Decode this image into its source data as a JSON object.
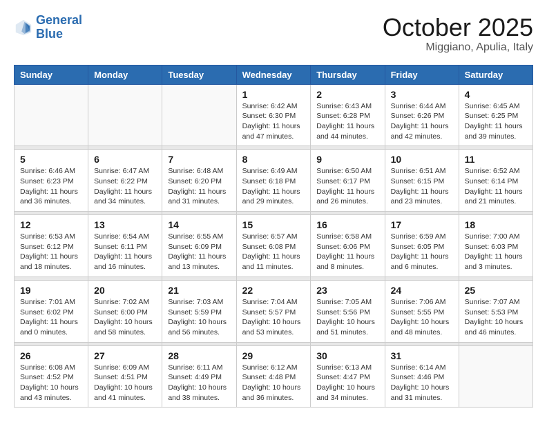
{
  "header": {
    "logo_line1": "General",
    "logo_line2": "Blue",
    "month": "October 2025",
    "location": "Miggiano, Apulia, Italy"
  },
  "weekdays": [
    "Sunday",
    "Monday",
    "Tuesday",
    "Wednesday",
    "Thursday",
    "Friday",
    "Saturday"
  ],
  "weeks": [
    [
      {
        "day": "",
        "info": ""
      },
      {
        "day": "",
        "info": ""
      },
      {
        "day": "",
        "info": ""
      },
      {
        "day": "1",
        "info": "Sunrise: 6:42 AM\nSunset: 6:30 PM\nDaylight: 11 hours\nand 47 minutes."
      },
      {
        "day": "2",
        "info": "Sunrise: 6:43 AM\nSunset: 6:28 PM\nDaylight: 11 hours\nand 44 minutes."
      },
      {
        "day": "3",
        "info": "Sunrise: 6:44 AM\nSunset: 6:26 PM\nDaylight: 11 hours\nand 42 minutes."
      },
      {
        "day": "4",
        "info": "Sunrise: 6:45 AM\nSunset: 6:25 PM\nDaylight: 11 hours\nand 39 minutes."
      }
    ],
    [
      {
        "day": "5",
        "info": "Sunrise: 6:46 AM\nSunset: 6:23 PM\nDaylight: 11 hours\nand 36 minutes."
      },
      {
        "day": "6",
        "info": "Sunrise: 6:47 AM\nSunset: 6:22 PM\nDaylight: 11 hours\nand 34 minutes."
      },
      {
        "day": "7",
        "info": "Sunrise: 6:48 AM\nSunset: 6:20 PM\nDaylight: 11 hours\nand 31 minutes."
      },
      {
        "day": "8",
        "info": "Sunrise: 6:49 AM\nSunset: 6:18 PM\nDaylight: 11 hours\nand 29 minutes."
      },
      {
        "day": "9",
        "info": "Sunrise: 6:50 AM\nSunset: 6:17 PM\nDaylight: 11 hours\nand 26 minutes."
      },
      {
        "day": "10",
        "info": "Sunrise: 6:51 AM\nSunset: 6:15 PM\nDaylight: 11 hours\nand 23 minutes."
      },
      {
        "day": "11",
        "info": "Sunrise: 6:52 AM\nSunset: 6:14 PM\nDaylight: 11 hours\nand 21 minutes."
      }
    ],
    [
      {
        "day": "12",
        "info": "Sunrise: 6:53 AM\nSunset: 6:12 PM\nDaylight: 11 hours\nand 18 minutes."
      },
      {
        "day": "13",
        "info": "Sunrise: 6:54 AM\nSunset: 6:11 PM\nDaylight: 11 hours\nand 16 minutes."
      },
      {
        "day": "14",
        "info": "Sunrise: 6:55 AM\nSunset: 6:09 PM\nDaylight: 11 hours\nand 13 minutes."
      },
      {
        "day": "15",
        "info": "Sunrise: 6:57 AM\nSunset: 6:08 PM\nDaylight: 11 hours\nand 11 minutes."
      },
      {
        "day": "16",
        "info": "Sunrise: 6:58 AM\nSunset: 6:06 PM\nDaylight: 11 hours\nand 8 minutes."
      },
      {
        "day": "17",
        "info": "Sunrise: 6:59 AM\nSunset: 6:05 PM\nDaylight: 11 hours\nand 6 minutes."
      },
      {
        "day": "18",
        "info": "Sunrise: 7:00 AM\nSunset: 6:03 PM\nDaylight: 11 hours\nand 3 minutes."
      }
    ],
    [
      {
        "day": "19",
        "info": "Sunrise: 7:01 AM\nSunset: 6:02 PM\nDaylight: 11 hours\nand 0 minutes."
      },
      {
        "day": "20",
        "info": "Sunrise: 7:02 AM\nSunset: 6:00 PM\nDaylight: 10 hours\nand 58 minutes."
      },
      {
        "day": "21",
        "info": "Sunrise: 7:03 AM\nSunset: 5:59 PM\nDaylight: 10 hours\nand 56 minutes."
      },
      {
        "day": "22",
        "info": "Sunrise: 7:04 AM\nSunset: 5:57 PM\nDaylight: 10 hours\nand 53 minutes."
      },
      {
        "day": "23",
        "info": "Sunrise: 7:05 AM\nSunset: 5:56 PM\nDaylight: 10 hours\nand 51 minutes."
      },
      {
        "day": "24",
        "info": "Sunrise: 7:06 AM\nSunset: 5:55 PM\nDaylight: 10 hours\nand 48 minutes."
      },
      {
        "day": "25",
        "info": "Sunrise: 7:07 AM\nSunset: 5:53 PM\nDaylight: 10 hours\nand 46 minutes."
      }
    ],
    [
      {
        "day": "26",
        "info": "Sunrise: 6:08 AM\nSunset: 4:52 PM\nDaylight: 10 hours\nand 43 minutes."
      },
      {
        "day": "27",
        "info": "Sunrise: 6:09 AM\nSunset: 4:51 PM\nDaylight: 10 hours\nand 41 minutes."
      },
      {
        "day": "28",
        "info": "Sunrise: 6:11 AM\nSunset: 4:49 PM\nDaylight: 10 hours\nand 38 minutes."
      },
      {
        "day": "29",
        "info": "Sunrise: 6:12 AM\nSunset: 4:48 PM\nDaylight: 10 hours\nand 36 minutes."
      },
      {
        "day": "30",
        "info": "Sunrise: 6:13 AM\nSunset: 4:47 PM\nDaylight: 10 hours\nand 34 minutes."
      },
      {
        "day": "31",
        "info": "Sunrise: 6:14 AM\nSunset: 4:46 PM\nDaylight: 10 hours\nand 31 minutes."
      },
      {
        "day": "",
        "info": ""
      }
    ]
  ]
}
